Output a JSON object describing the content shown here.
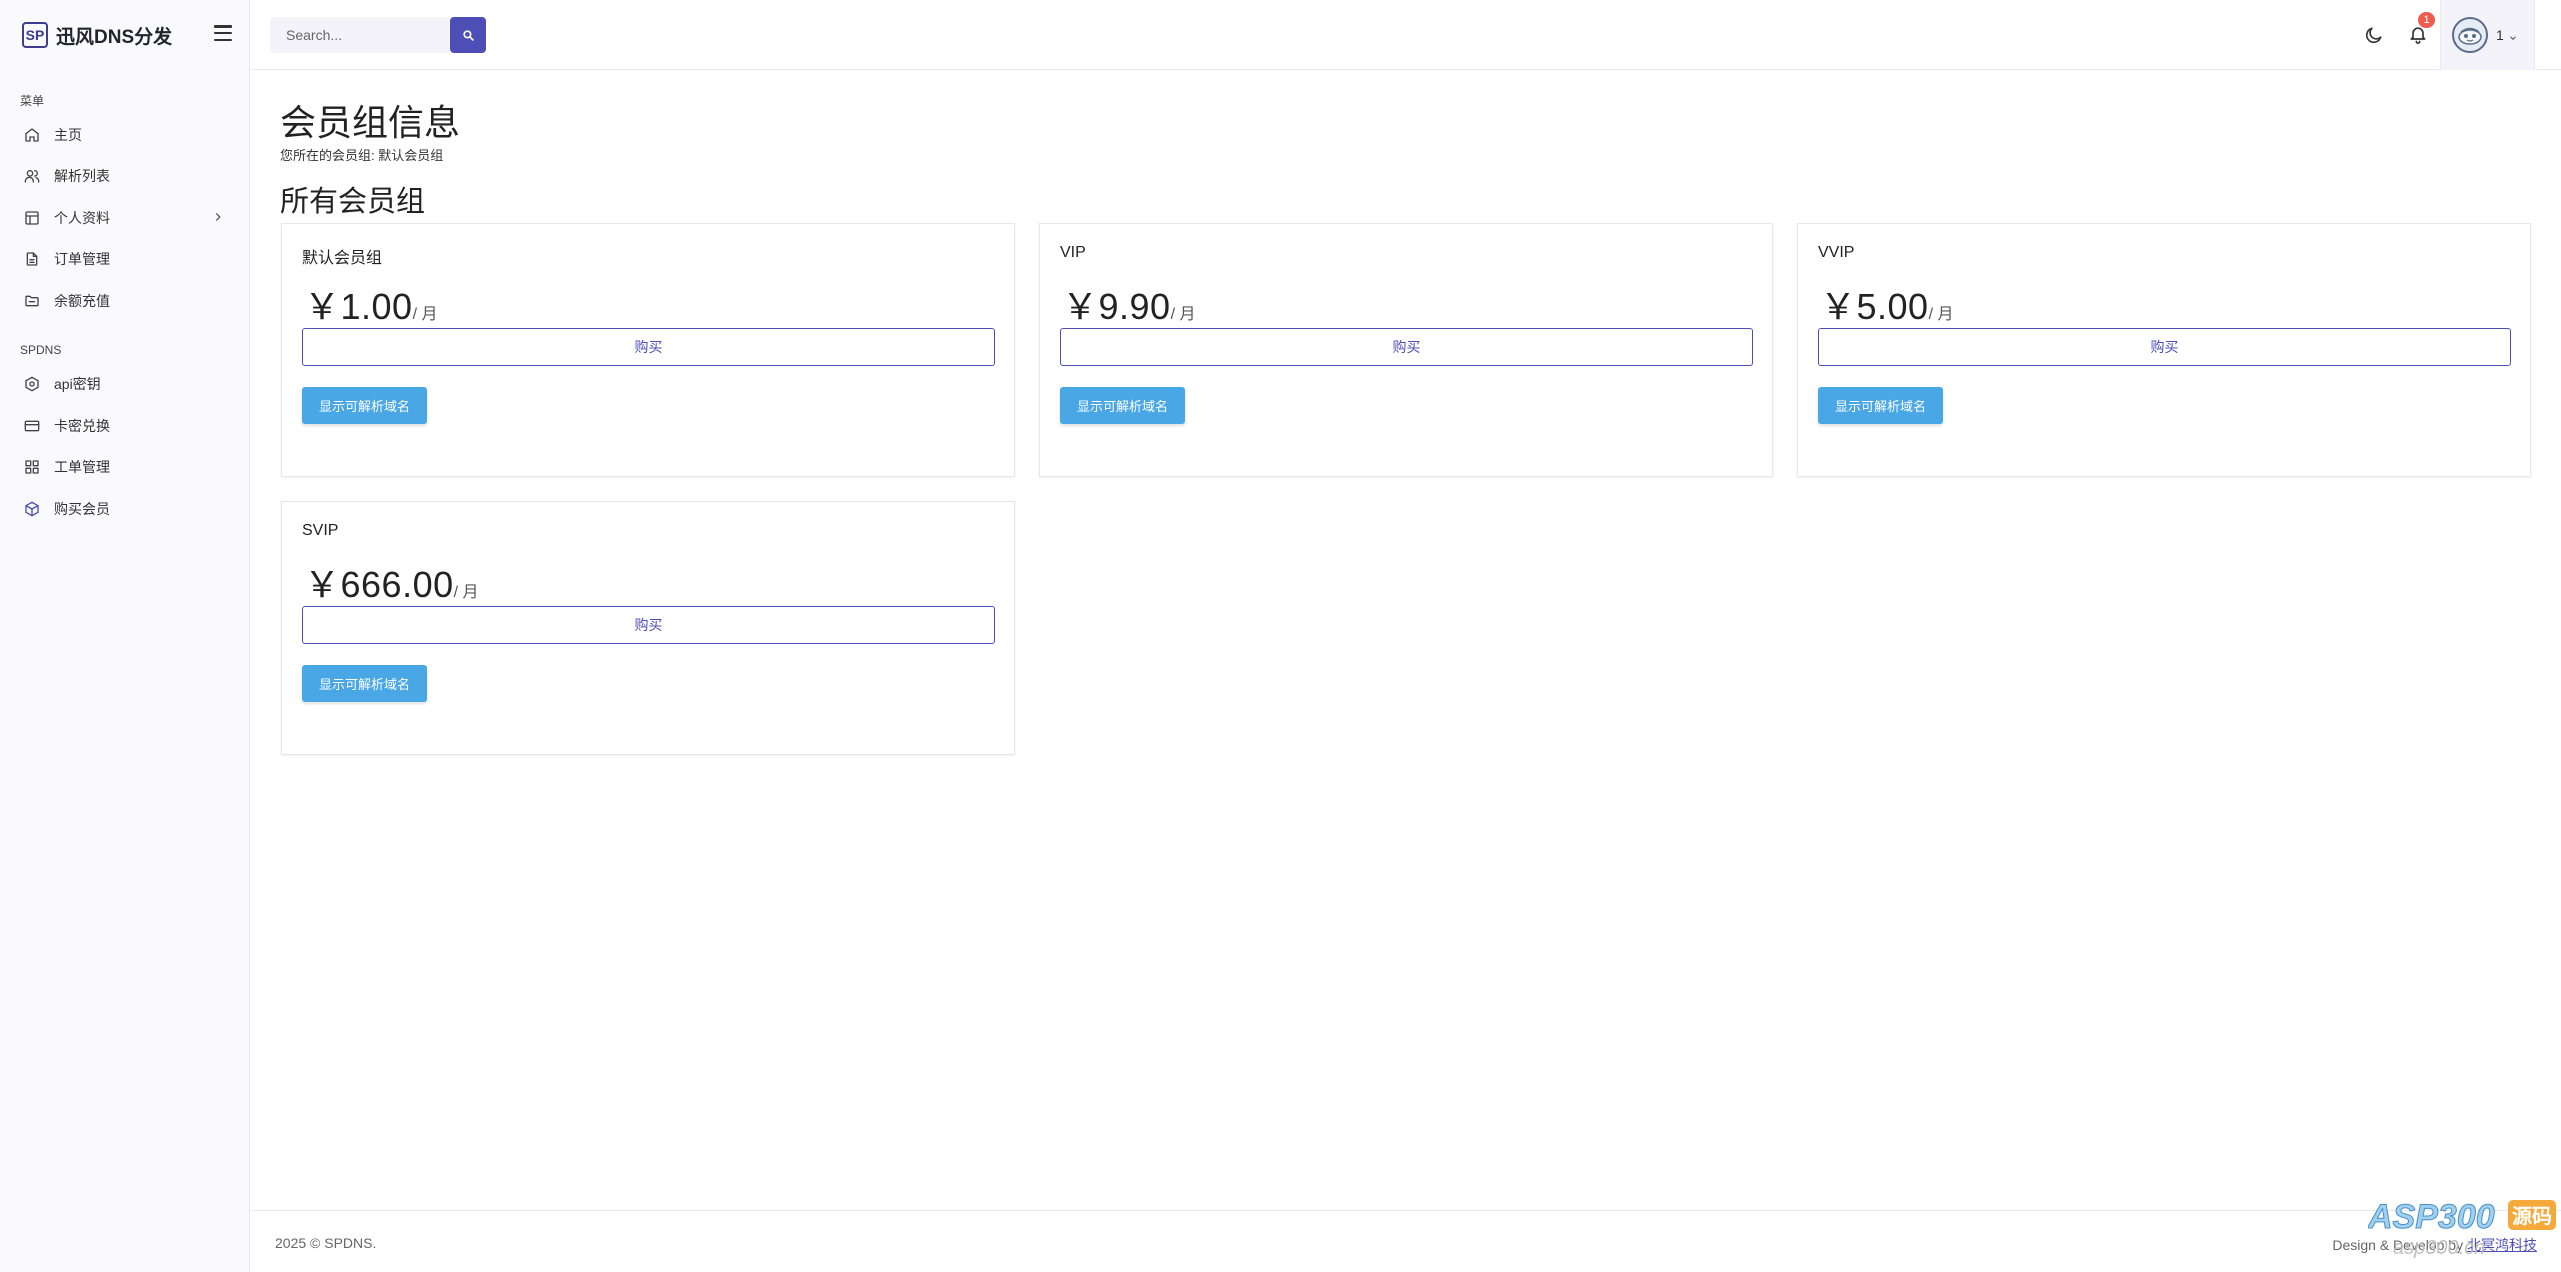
{
  "brand": {
    "logo": "SP",
    "name": "迅风DNS分发"
  },
  "search": {
    "placeholder": "Search..."
  },
  "menu": {
    "section1": "菜单",
    "section2": "SPDNS",
    "items1": [
      {
        "label": "主页",
        "icon": "home-icon"
      },
      {
        "label": "解析列表",
        "icon": "users-icon"
      },
      {
        "label": "个人资料",
        "icon": "layout-icon"
      },
      {
        "label": "订单管理",
        "icon": "file-icon"
      },
      {
        "label": "余额充值",
        "icon": "folder-icon"
      }
    ],
    "items2": [
      {
        "label": "api密钥",
        "icon": "hexagon-icon"
      },
      {
        "label": "卡密兑换",
        "icon": "credit-card-icon"
      },
      {
        "label": "工单管理",
        "icon": "grid-icon"
      },
      {
        "label": "购买会员",
        "icon": "box-icon"
      }
    ]
  },
  "topbar": {
    "notification_count": "1",
    "user_name": "1"
  },
  "page": {
    "title": "会员组信息",
    "current_group": "您所在的会员组: 默认会员组",
    "section_title": "所有会员组"
  },
  "groups": [
    {
      "name": "默认会员组",
      "price": "￥1.00",
      "per": "/ 月",
      "buy": "购买",
      "show": "显示可解析域名"
    },
    {
      "name": "VIP",
      "price": "￥9.90",
      "per": "/ 月",
      "buy": "购买",
      "show": "显示可解析域名"
    },
    {
      "name": "VVIP",
      "price": "￥5.00",
      "per": "/ 月",
      "buy": "购买",
      "show": "显示可解析域名"
    },
    {
      "name": "SVIP",
      "price": "￥666.00",
      "per": "/ 月",
      "buy": "购买",
      "show": "显示可解析域名"
    }
  ],
  "footer": {
    "left": "2025 © SPDNS.",
    "right_prefix": "Design & Develop by ",
    "right_link": "北冥鸿科技"
  },
  "watermark": {
    "text": "ASP300",
    "badge": "源码",
    "sub": "asp300.cn"
  },
  "colors": {
    "accent": "#4e4fb6",
    "info": "#4aa7e6",
    "badge": "#f15a4c"
  }
}
